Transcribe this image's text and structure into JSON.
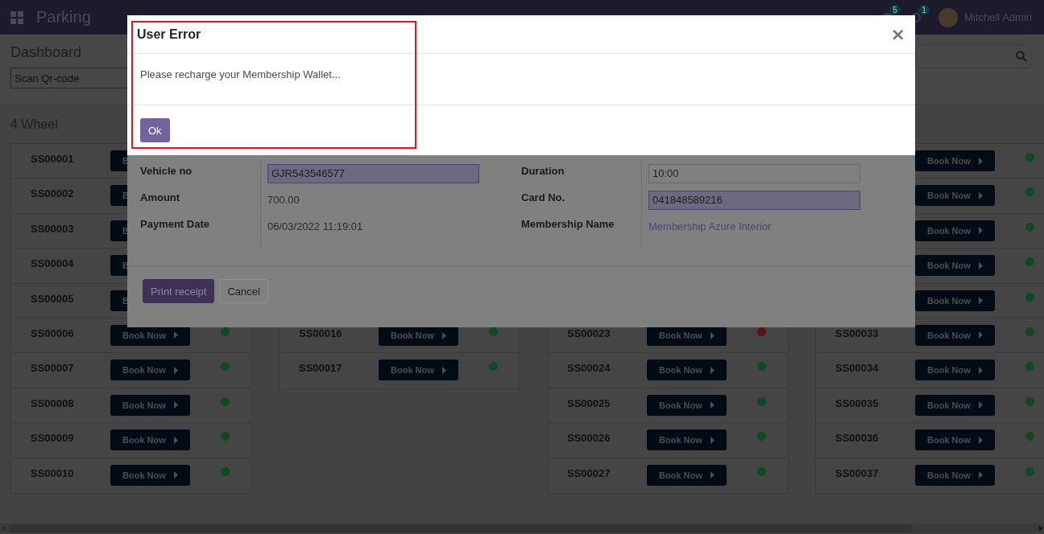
{
  "navbar": {
    "app_name": "Parking",
    "messages_count": "5",
    "activities_count": "1",
    "user": "Mitchell Admin"
  },
  "control_panel": {
    "breadcrumb": "Dashboard",
    "scan_field": {
      "placeholder": "Scan Qr-code"
    }
  },
  "section_title": "4 Wheel",
  "columns": [
    {
      "kind": "full",
      "slots": [
        {
          "name": "SS00001",
          "button": "B"
        },
        {
          "name": "SS00002",
          "button": "B"
        },
        {
          "name": "SS00003",
          "button": "B"
        },
        {
          "name": "SS00004",
          "button": "B"
        },
        {
          "name": "SS00005",
          "button": "B"
        },
        {
          "name": "SS00006",
          "button": "Book Now",
          "color": "#0e4a22"
        },
        {
          "name": "SS00007",
          "button": "Book Now",
          "color": "#0e4a22"
        },
        {
          "name": "SS00008",
          "button": "Book Now",
          "color": "#0e4a22"
        },
        {
          "name": "SS00009",
          "button": "Book Now",
          "color": "#0e4a22"
        },
        {
          "name": "SS00010",
          "button": "Book Now",
          "color": "#0e4a22"
        }
      ]
    },
    {
      "kind": "lower",
      "slots": [
        {
          "name": "SS00016",
          "button": "Book Now",
          "color": "#0e4a22"
        },
        {
          "name": "SS00017",
          "button": "Book Now",
          "color": "#0e4a22"
        }
      ]
    },
    {
      "kind": "lower",
      "slots": [
        {
          "name": "SS00023",
          "button": "Book Now",
          "color": "#5a0f1c"
        },
        {
          "name": "SS00024",
          "button": "Book Now",
          "color": "#0e4a22"
        },
        {
          "name": "SS00025",
          "button": "Book Now",
          "color": "#0e4a22"
        },
        {
          "name": "SS00026",
          "button": "Book Now",
          "color": "#0e4a22"
        },
        {
          "name": "SS00027",
          "button": "Book Now",
          "color": "#0e4a22"
        }
      ]
    },
    {
      "kind": "full",
      "slots": [
        {
          "button": "Book Now",
          "color": "#0e4a22"
        },
        {
          "button": "Book Now",
          "color": "#0e4a22"
        },
        {
          "button": "Book Now",
          "color": "#0e4a22"
        },
        {
          "button": "Book Now",
          "color": "#0e4a22"
        },
        {
          "button": "Book Now",
          "color": "#0e4a22"
        },
        {
          "name": "SS00033",
          "button": "Book Now",
          "color": "#0e4a22"
        },
        {
          "name": "SS00034",
          "button": "Book Now",
          "color": "#0e4a22"
        },
        {
          "name": "SS00035",
          "button": "Book Now",
          "color": "#0e4a22"
        },
        {
          "name": "SS00036",
          "button": "Book Now",
          "color": "#0e4a22"
        },
        {
          "name": "SS00037",
          "button": "Book Now",
          "color": "#0e4a22"
        }
      ]
    }
  ],
  "payment_dialog": {
    "left_fields": [
      {
        "label": "Vehicle no",
        "value": "GJR543546577",
        "kind": "input",
        "required": true
      },
      {
        "label": "Amount",
        "value": "700.00",
        "kind": "text"
      },
      {
        "label": "Payment Date",
        "value": "06/03/2022 11:19:01",
        "kind": "text"
      }
    ],
    "right_fields": [
      {
        "label": "Duration",
        "value": "10:00",
        "kind": "input",
        "required": false
      },
      {
        "label": "Card No.",
        "value": "041848589216",
        "kind": "input",
        "required": true
      },
      {
        "label": "Membership Name",
        "value": "Membership Azure Interior",
        "kind": "link"
      }
    ],
    "buttons": [
      {
        "label": "Print receipt",
        "kind": "primary"
      },
      {
        "label": "Cancel",
        "kind": "secondary"
      }
    ]
  },
  "error_dialog": {
    "title": "User Error",
    "close": "×",
    "message": "Please recharge your Membership Wallet...",
    "button": "Ok"
  }
}
